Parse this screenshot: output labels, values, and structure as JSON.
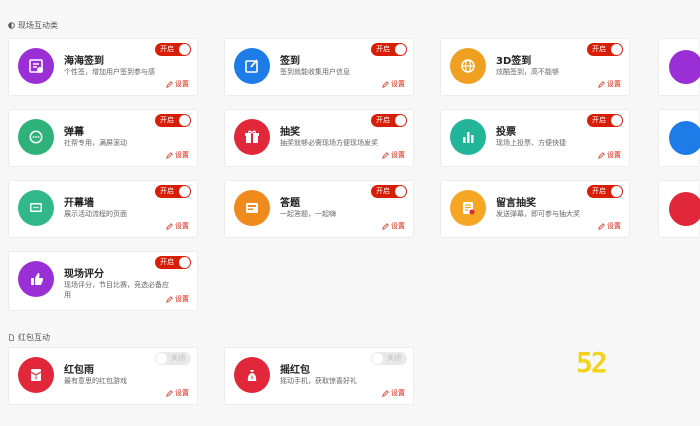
{
  "sections": {
    "interactive_title": "现场互动类",
    "redpacket_title": "红包互动"
  },
  "cards": [
    {
      "name": "海海签到",
      "desc": "个性签，增加用户签到参与感",
      "toggle": "开启",
      "setting": "设置",
      "color": "#9b2fd6",
      "icon": "sign-in-icon"
    },
    {
      "name": "签到",
      "desc": "签到就能收集用户信息",
      "toggle": "开启",
      "setting": "设置",
      "color": "#1e7ce8",
      "icon": "edit-icon"
    },
    {
      "name": "3D签到",
      "desc": "炫酷签到，高不能够",
      "toggle": "开启",
      "setting": "设置",
      "color": "#f0a020",
      "icon": "globe-icon"
    },
    {
      "name": "弹幕",
      "desc": "社帮专用，满屏滚动",
      "toggle": "开启",
      "setting": "设置",
      "color": "#2fb27a",
      "icon": "barrage-icon"
    },
    {
      "name": "抽奖",
      "desc": "抽奖就够必需现场方便现场发奖",
      "toggle": "开启",
      "setting": "设置",
      "color": "#e0283a",
      "icon": "gift-icon"
    },
    {
      "name": "投票",
      "desc": "现场上投票、方便快捷",
      "toggle": "开启",
      "setting": "设置",
      "color": "#22b59a",
      "icon": "chart-icon"
    },
    {
      "name": "开幕墙",
      "desc": "展示活动流程的页面",
      "toggle": "开启",
      "setting": "设置",
      "color": "#30b88a",
      "icon": "screen-icon"
    },
    {
      "name": "答题",
      "desc": "一起答题，一起嗨",
      "toggle": "开启",
      "setting": "设置",
      "color": "#f08a1c",
      "icon": "quiz-icon"
    },
    {
      "name": "留言抽奖",
      "desc": "发送弹幕，即可参与抽大奖",
      "toggle": "开启",
      "setting": "设置",
      "color": "#f5a623",
      "icon": "message-lottery-icon"
    },
    {
      "name": "现场评分",
      "desc": "现场评分，节目比赛，竞选必备应用",
      "toggle": "开启",
      "setting": "设置",
      "color": "#9b2fd6",
      "icon": "thumbs-up-icon"
    }
  ],
  "redpacket_cards": [
    {
      "name": "红包雨",
      "desc": "最有意思的红包游戏",
      "toggle": "关闭",
      "setting": "设置",
      "color": "#e0283a",
      "icon": "red-envelope-icon"
    },
    {
      "name": "摇红包",
      "desc": "摇动手机，获取惊喜好礼",
      "toggle": "关闭",
      "setting": "设置",
      "color": "#e0283a",
      "icon": "money-bag-icon"
    }
  ],
  "stub_colors": [
    "#9b2fd6",
    "#1e7ce8",
    "#e0283a"
  ],
  "watermark": "52"
}
